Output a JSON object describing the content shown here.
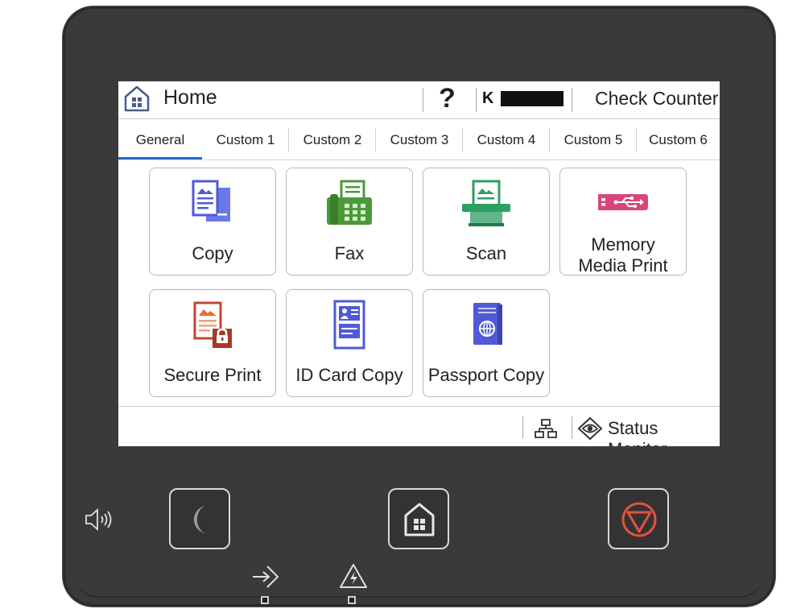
{
  "header": {
    "title": "Home",
    "help_label": "?",
    "ink_label": "K",
    "ink_level": 1.0,
    "check_counter": "Check Counter"
  },
  "tabs": [
    {
      "label": "General",
      "active": true
    },
    {
      "label": "Custom 1"
    },
    {
      "label": "Custom 2"
    },
    {
      "label": "Custom 3"
    },
    {
      "label": "Custom 4"
    },
    {
      "label": "Custom 5"
    },
    {
      "label": "Custom 6"
    }
  ],
  "tiles": {
    "copy": {
      "label": "Copy",
      "icon": "copy-icon"
    },
    "fax": {
      "label": "Fax",
      "icon": "fax-icon"
    },
    "scan": {
      "label": "Scan",
      "icon": "scan-icon"
    },
    "memory": {
      "line1": "Memory",
      "line2": "Media Print",
      "icon": "usb-icon"
    },
    "secure_print": {
      "label": "Secure Print",
      "icon": "secure-print-icon"
    },
    "id_card_copy": {
      "label": "ID Card Copy",
      "icon": "id-card-icon"
    },
    "passport_copy": {
      "label": "Passport Copy",
      "icon": "passport-icon"
    }
  },
  "status_bar": {
    "status_monitor": "Status Monitor"
  },
  "colors": {
    "bezel": "#3a3a3c",
    "tab_active": "#1f6fd0",
    "stop_button": "#e2533b",
    "copy_blue": "#4f5bd5",
    "fax_green": "#4b9a3a",
    "scan_green": "#2e9e62",
    "usb_pink": "#d9457a",
    "secure_red": "#c0472b"
  }
}
